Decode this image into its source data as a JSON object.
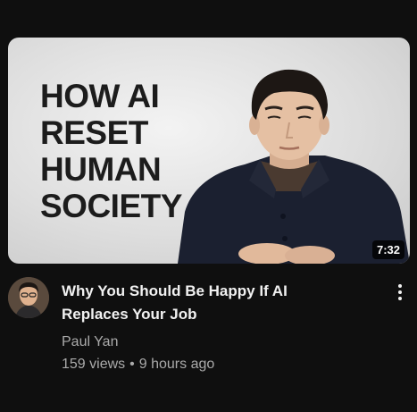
{
  "video": {
    "thumbnail_text": [
      "HOW AI",
      "RESET",
      "HUMAN",
      "SOCIETY"
    ],
    "duration": "7:32",
    "title_lines": [
      "Why You Should Be Happy If AI",
      "Replaces Your Job"
    ],
    "channel": "Paul Yan",
    "views": "159 views",
    "separator": "•",
    "age": "9 hours ago"
  },
  "icons": {
    "menu": "more-vert-icon"
  },
  "colors": {
    "background": "#0f0f0f",
    "title": "#f1f1f1",
    "secondary_text": "#aaaaaa"
  }
}
